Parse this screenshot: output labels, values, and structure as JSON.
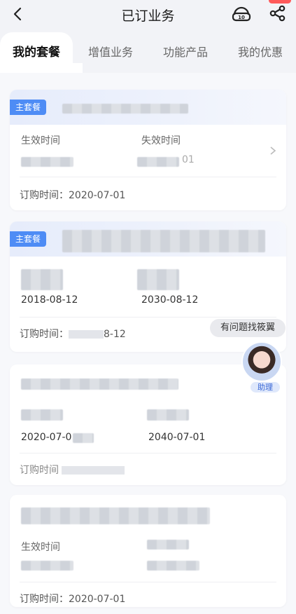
{
  "header": {
    "title": "已订业务",
    "back_icon": "chevron-left-icon",
    "service_icon": "customer-service-icon",
    "share_icon": "share-icon"
  },
  "tabs": [
    {
      "label": "我的套餐",
      "active": true
    },
    {
      "label": "增值业务",
      "active": false
    },
    {
      "label": "功能产品",
      "active": false
    },
    {
      "label": "我的优惠",
      "active": false
    }
  ],
  "cards": [
    {
      "tag": "主套餐",
      "effective_label": "生效时间",
      "expire_label": "失效时间",
      "expire_value_fragment": "01",
      "order_label": "订购时间：",
      "order_value": "2020-07-01"
    },
    {
      "tag": "主套餐",
      "effective_value": "2018-08-12",
      "expire_value": "2030-08-12",
      "order_label": "订购时间：",
      "order_value_fragment": "8-12"
    },
    {
      "effective_value": "2020-07-0",
      "expire_value": "2040-07-01",
      "order_label_fragment": "订购时间"
    },
    {
      "effective_label": "生效时间",
      "order_label": "订购时间：",
      "order_value": "2020-07-01"
    }
  ],
  "assistant": {
    "pill_text": "有问题找筱翼",
    "avatar_label": "助理"
  },
  "colors": {
    "accent": "#4e8cf5",
    "background": "#f2f3f7",
    "card": "#ffffff"
  }
}
